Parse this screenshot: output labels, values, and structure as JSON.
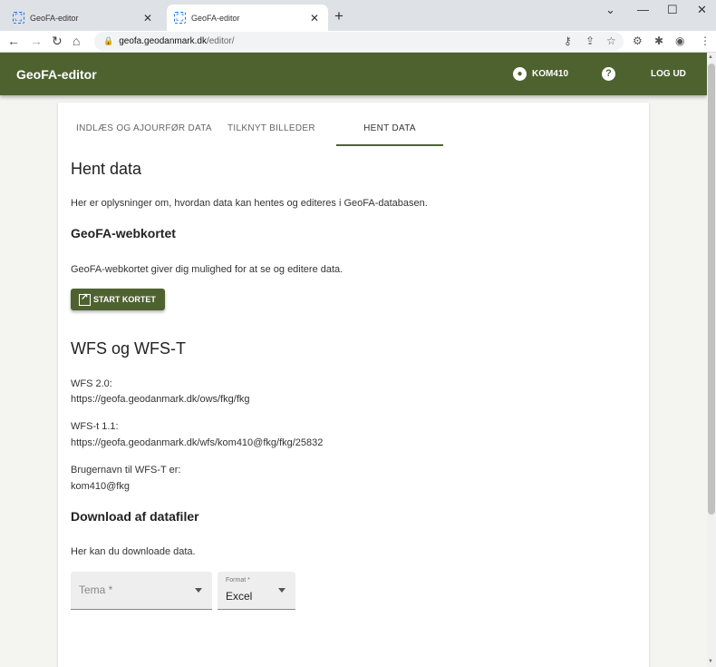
{
  "browser": {
    "tabs": [
      {
        "title": "GeoFA-editor",
        "active": false
      },
      {
        "title": "GeoFA-editor",
        "active": true
      }
    ],
    "new_tab": "+",
    "window_controls": {
      "minimize": "—",
      "maximize": "☐",
      "close": "✕",
      "chevron": "⌄"
    },
    "url_host": "geofa.geodanmark.dk",
    "url_path": "/editor/"
  },
  "app": {
    "brand": "GeoFA-editor",
    "user": "KOM410",
    "help": "?",
    "logout": "LOG UD",
    "accent": "#4e6230"
  },
  "tabs": [
    "INDLÆS OG AJOURFØR DATA",
    "TILKNYT BILLEDER",
    "HENT DATA"
  ],
  "active_tab": "HENT DATA",
  "content": {
    "title": "Hent data",
    "intro": "Her er oplysninger om, hvordan data kan hentes og editeres i GeoFA-databasen.",
    "webkort_heading": "GeoFA-webkortet",
    "webkort_text": "GeoFA-webkortet giver dig mulighed for at se og editere data.",
    "start_button": "START KORTET",
    "wfs_heading": "WFS og WFS-T",
    "wfs_label": "WFS 2.0:",
    "wfs_url": "https://geofa.geodanmark.dk/ows/fkg/fkg",
    "wfst_label": "WFS-t 1.1:",
    "wfst_url": "https://geofa.geodanmark.dk/wfs/kom410@fkg/fkg/25832",
    "user_label": "Brugernavn til WFS-T er:",
    "user_value": "kom410@fkg",
    "download_heading": "Download af datafiler",
    "download_text": "Her kan du downloade data.",
    "tema_placeholder": "Tema *",
    "format_label": "Format *",
    "format_value": "Excel"
  }
}
